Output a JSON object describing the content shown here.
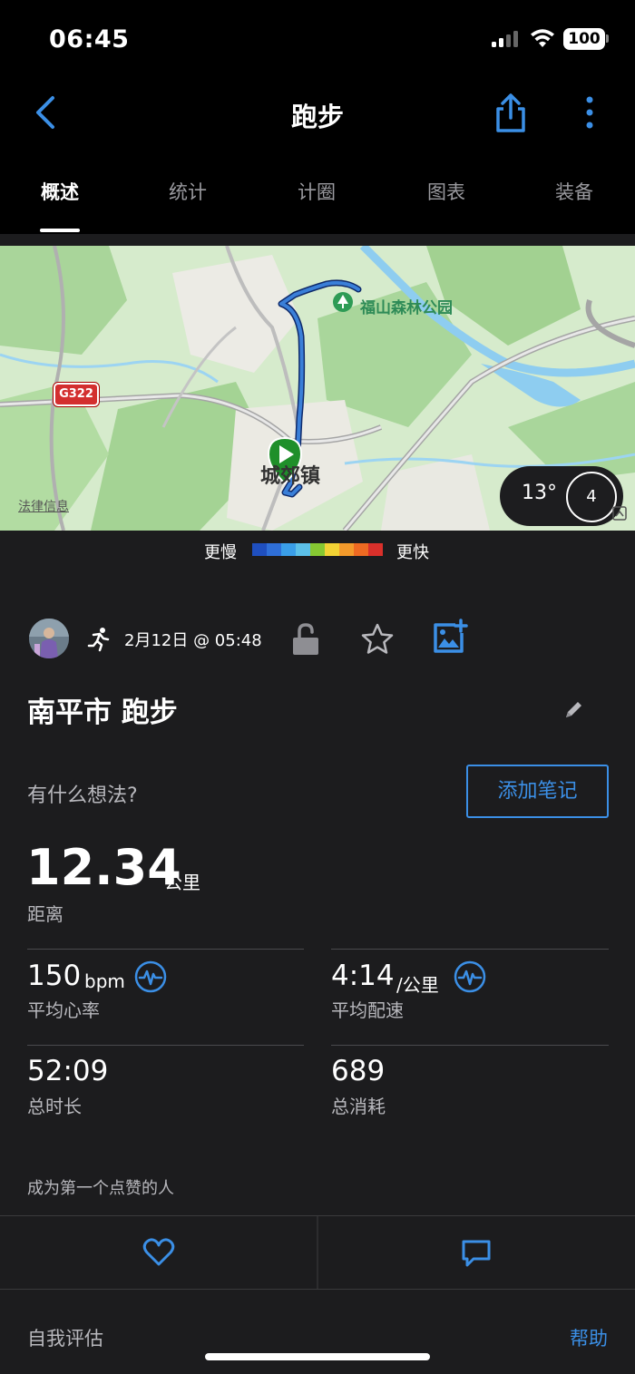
{
  "status": {
    "time": "06:45",
    "battery": "100"
  },
  "nav": {
    "title": "跑步"
  },
  "tabs": [
    "概述",
    "统计",
    "计圈",
    "图表",
    "装备"
  ],
  "map": {
    "park_label": "福山森林公园",
    "town_label": "城郊镇",
    "road_badge": "G322",
    "legal_label": "法律信息",
    "weather": {
      "temperature": "13°",
      "wind": "4"
    }
  },
  "legend": {
    "slow": "更慢",
    "fast": "更快",
    "colors": [
      "#1f4fbf",
      "#2f6fd8",
      "#3a9ee8",
      "#5cc0e8",
      "#86c832",
      "#f2d234",
      "#f39a2b",
      "#ee6a22",
      "#d9302b"
    ]
  },
  "activity": {
    "date": "2月12日 @ 05:48",
    "title": "南平市 跑步",
    "thoughts_placeholder": "有什么想法?",
    "add_note": "添加笔记"
  },
  "stats": {
    "distance": {
      "value": "12.34",
      "unit": "公里",
      "label": "距离"
    },
    "heart_rate": {
      "value": "150",
      "unit": "bpm",
      "label": "平均心率"
    },
    "pace": {
      "value": "4:14",
      "unit": "/公里",
      "label": "平均配速"
    },
    "duration": {
      "value": "52:09",
      "label": "总时长"
    },
    "calories": {
      "value": "689",
      "label": "总消耗"
    }
  },
  "social": {
    "likes_text": "成为第一个点赞的人"
  },
  "footer": {
    "self_eval": "自我评估",
    "help": "帮助"
  },
  "colors": {
    "accent": "#3b8fe6",
    "background": "#1c1c1e"
  }
}
